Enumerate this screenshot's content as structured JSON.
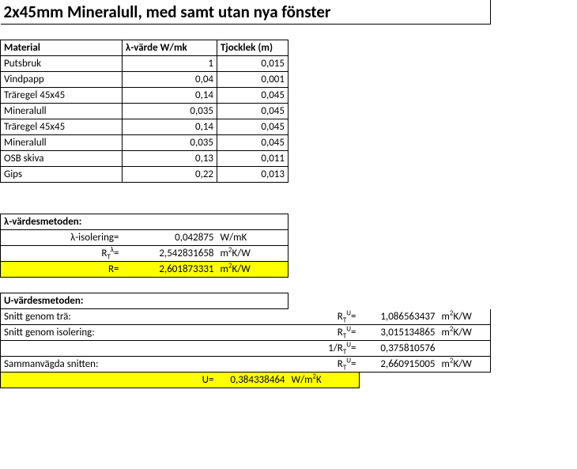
{
  "title": "2x45mm Mineralull, med samt utan nya fönster",
  "headers": {
    "material": "Material",
    "lambda": "λ-värde W/mk",
    "thickness": "Tjocklek (m)"
  },
  "materials": [
    {
      "name": "Putsbruk",
      "lambda": "1",
      "t": "0,015"
    },
    {
      "name": "Vindpapp",
      "lambda": "0,04",
      "t": "0,001"
    },
    {
      "name": "Träregel 45x45",
      "lambda": "0,14",
      "t": "0,045"
    },
    {
      "name": "Mineralull",
      "lambda": "0,035",
      "t": "0,045"
    },
    {
      "name": "Träregel 45x45",
      "lambda": "0,14",
      "t": "0,045"
    },
    {
      "name": "Mineralull",
      "lambda": "0,035",
      "t": "0,045"
    },
    {
      "name": "OSB skiva",
      "lambda": "0,13",
      "t": "0,011"
    },
    {
      "name": "Gips",
      "lambda": "0,22",
      "t": "0,013"
    }
  ],
  "lambdaMethod": {
    "header": "λ-värdesmetoden:",
    "rows": {
      "iso_label": "λ-isolering=",
      "iso_val": "0,042875",
      "iso_unit": "W/mK",
      "rt_val": "2,542831658",
      "r_label": "R=",
      "r_val": "2,601873331"
    }
  },
  "uMethod": {
    "header": "U-värdesmetoden:",
    "wood_label": "Snitt genom trä:",
    "wood_val": "1,086563437",
    "iso_label": "Snitt genom isolering:",
    "iso_val": "3,015134865",
    "inv_val": "0,375810576",
    "comb_label": "Sammanvägda snitten:",
    "comb_val": "2,660915005",
    "u_label": "U=",
    "u_val": "0,384338464"
  },
  "units": {
    "m2kw": "m²K/W",
    "wm2k": "W/m²K"
  },
  "chart_data": {
    "type": "table",
    "title": "2x45mm Mineralull, med samt utan nya fönster",
    "columns": [
      "Material",
      "λ-värde W/mk",
      "Tjocklek (m)"
    ],
    "rows": [
      [
        "Putsbruk",
        1,
        0.015
      ],
      [
        "Vindpapp",
        0.04,
        0.001
      ],
      [
        "Träregel 45x45",
        0.14,
        0.045
      ],
      [
        "Mineralull",
        0.035,
        0.045
      ],
      [
        "Träregel 45x45",
        0.14,
        0.045
      ],
      [
        "Mineralull",
        0.035,
        0.045
      ],
      [
        "OSB skiva",
        0.13,
        0.011
      ],
      [
        "Gips",
        0.22,
        0.013
      ]
    ],
    "lambda_method": {
      "lambda_isolering_W_per_mK": 0.042875,
      "RT_lambda_m2K_per_W": 2.542831658,
      "R_m2K_per_W": 2.601873331
    },
    "u_method": {
      "snitt_genom_tra_RT_U_m2K_per_W": 1.086563437,
      "snitt_genom_isolering_RT_U_m2K_per_W": 3.015134865,
      "inverse_RT_U": 0.375810576,
      "sammanvagda_snitten_RT_U_m2K_per_W": 2.660915005,
      "U_W_per_m2K": 0.384338464
    }
  }
}
